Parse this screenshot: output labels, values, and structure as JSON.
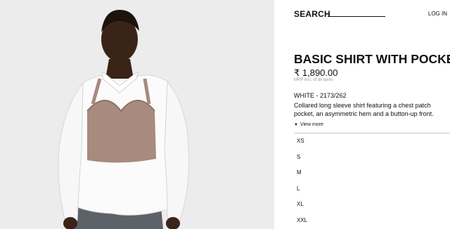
{
  "header": {
    "search_label": "SEARCH",
    "login_label": "LOG IN"
  },
  "product": {
    "title": "BASIC SHIRT WITH POCKET",
    "price": "₹ 1,890.00",
    "tax_note": "MRP incl. of all taxes",
    "color_ref": "WHITE - 2173/262",
    "description": "Collared long sleeve shirt featuring a chest patch pocket, an asymmetric hem and a button-up front.",
    "view_more": "View more"
  },
  "sizes": [
    "XS",
    "S",
    "M",
    "L",
    "XL",
    "XXL"
  ]
}
